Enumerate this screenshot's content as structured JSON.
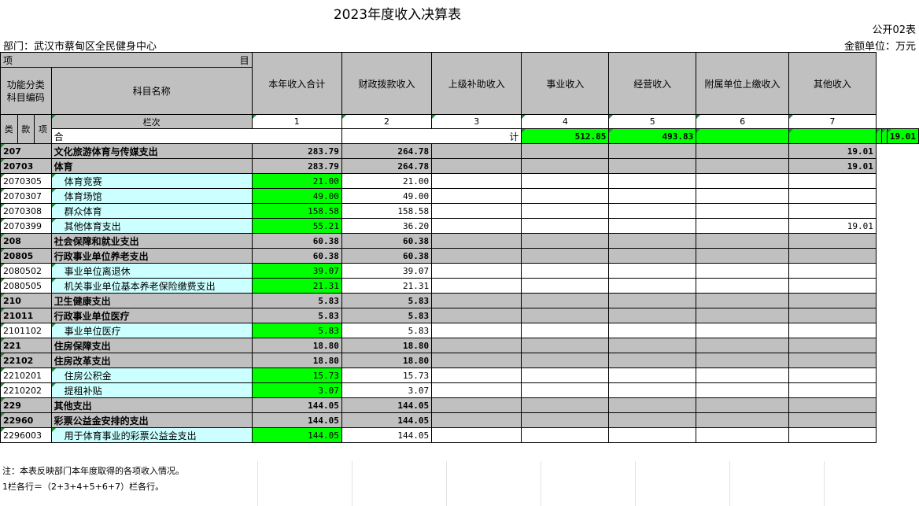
{
  "title": "2023年度收入决算表",
  "form_no": "公开02表",
  "department": "部门：武汉市蔡甸区全民健身中心",
  "unit": "金额单位：万元",
  "header": {
    "item_left": "项",
    "item_right": "目",
    "func_code": "功能分类科目编码",
    "subject_name": "科目名称",
    "col_row_label": "栏次",
    "lei": "类",
    "kuan": "款",
    "xiang": "项",
    "columns": [
      "本年收入合计",
      "财政拨款收入",
      "上级补助收入",
      "事业收入",
      "经营收入",
      "附属单位上缴收入",
      "其他收入"
    ],
    "column_numbers": [
      "1",
      "2",
      "3",
      "4",
      "5",
      "6",
      "7"
    ]
  },
  "total_row": {
    "label_left": "合",
    "label_right": "计",
    "values": [
      "512.85",
      "493.83",
      "",
      "",
      "",
      "",
      "19.01"
    ]
  },
  "rows": [
    {
      "code": "207",
      "name": "文化旅游体育与传媒支出",
      "level": "major",
      "values": [
        "283.79",
        "264.78",
        "",
        "",
        "",
        "",
        "19.01"
      ]
    },
    {
      "code": "20703",
      "name": "体育",
      "level": "major",
      "values": [
        "283.79",
        "264.78",
        "",
        "",
        "",
        "",
        "19.01"
      ]
    },
    {
      "code": "2070305",
      "name": "体育竞赛",
      "level": "minor",
      "values": [
        "21.00",
        "21.00",
        "",
        "",
        "",
        "",
        ""
      ]
    },
    {
      "code": "2070307",
      "name": "体育场馆",
      "level": "minor",
      "values": [
        "49.00",
        "49.00",
        "",
        "",
        "",
        "",
        ""
      ]
    },
    {
      "code": "2070308",
      "name": "群众体育",
      "level": "minor",
      "values": [
        "158.58",
        "158.58",
        "",
        "",
        "",
        "",
        ""
      ]
    },
    {
      "code": "2070399",
      "name": "其他体育支出",
      "level": "minor",
      "values": [
        "55.21",
        "36.20",
        "",
        "",
        "",
        "",
        "19.01"
      ]
    },
    {
      "code": "208",
      "name": "社会保障和就业支出",
      "level": "major",
      "values": [
        "60.38",
        "60.38",
        "",
        "",
        "",
        "",
        ""
      ]
    },
    {
      "code": "20805",
      "name": "行政事业单位养老支出",
      "level": "major",
      "values": [
        "60.38",
        "60.38",
        "",
        "",
        "",
        "",
        ""
      ]
    },
    {
      "code": "2080502",
      "name": "事业单位离退休",
      "level": "minor",
      "values": [
        "39.07",
        "39.07",
        "",
        "",
        "",
        "",
        ""
      ]
    },
    {
      "code": "2080505",
      "name": "机关事业单位基本养老保险缴费支出",
      "level": "minor",
      "values": [
        "21.31",
        "21.31",
        "",
        "",
        "",
        "",
        ""
      ]
    },
    {
      "code": "210",
      "name": "卫生健康支出",
      "level": "major",
      "values": [
        "5.83",
        "5.83",
        "",
        "",
        "",
        "",
        ""
      ]
    },
    {
      "code": "21011",
      "name": "行政事业单位医疗",
      "level": "major",
      "values": [
        "5.83",
        "5.83",
        "",
        "",
        "",
        "",
        ""
      ]
    },
    {
      "code": "2101102",
      "name": "事业单位医疗",
      "level": "minor",
      "values": [
        "5.83",
        "5.83",
        "",
        "",
        "",
        "",
        ""
      ]
    },
    {
      "code": "221",
      "name": "住房保障支出",
      "level": "major",
      "values": [
        "18.80",
        "18.80",
        "",
        "",
        "",
        "",
        ""
      ]
    },
    {
      "code": "22102",
      "name": "住房改革支出",
      "level": "major",
      "values": [
        "18.80",
        "18.80",
        "",
        "",
        "",
        "",
        ""
      ]
    },
    {
      "code": "2210201",
      "name": "住房公积金",
      "level": "minor",
      "values": [
        "15.73",
        "15.73",
        "",
        "",
        "",
        "",
        ""
      ]
    },
    {
      "code": "2210202",
      "name": "提租补贴",
      "level": "minor",
      "values": [
        "3.07",
        "3.07",
        "",
        "",
        "",
        "",
        ""
      ]
    },
    {
      "code": "229",
      "name": "其他支出",
      "level": "major",
      "values": [
        "144.05",
        "144.05",
        "",
        "",
        "",
        "",
        ""
      ]
    },
    {
      "code": "22960",
      "name": "彩票公益金安排的支出",
      "level": "major",
      "values": [
        "144.05",
        "144.05",
        "",
        "",
        "",
        "",
        ""
      ]
    },
    {
      "code": "2296003",
      "name": "用于体育事业的彩票公益金支出",
      "level": "minor",
      "values": [
        "144.05",
        "144.05",
        "",
        "",
        "",
        "",
        ""
      ]
    }
  ],
  "notes": [
    "注：本表反映部门本年度取得的各项收入情况。",
    "1栏各行＝（2+3+4+5+6+7）栏各行。"
  ],
  "colors": {
    "header_grey": "#c0c0c0",
    "highlight_green": "#00ff00",
    "name_cyan": "#ccffff",
    "corner_mark": "#1c8f3a"
  }
}
